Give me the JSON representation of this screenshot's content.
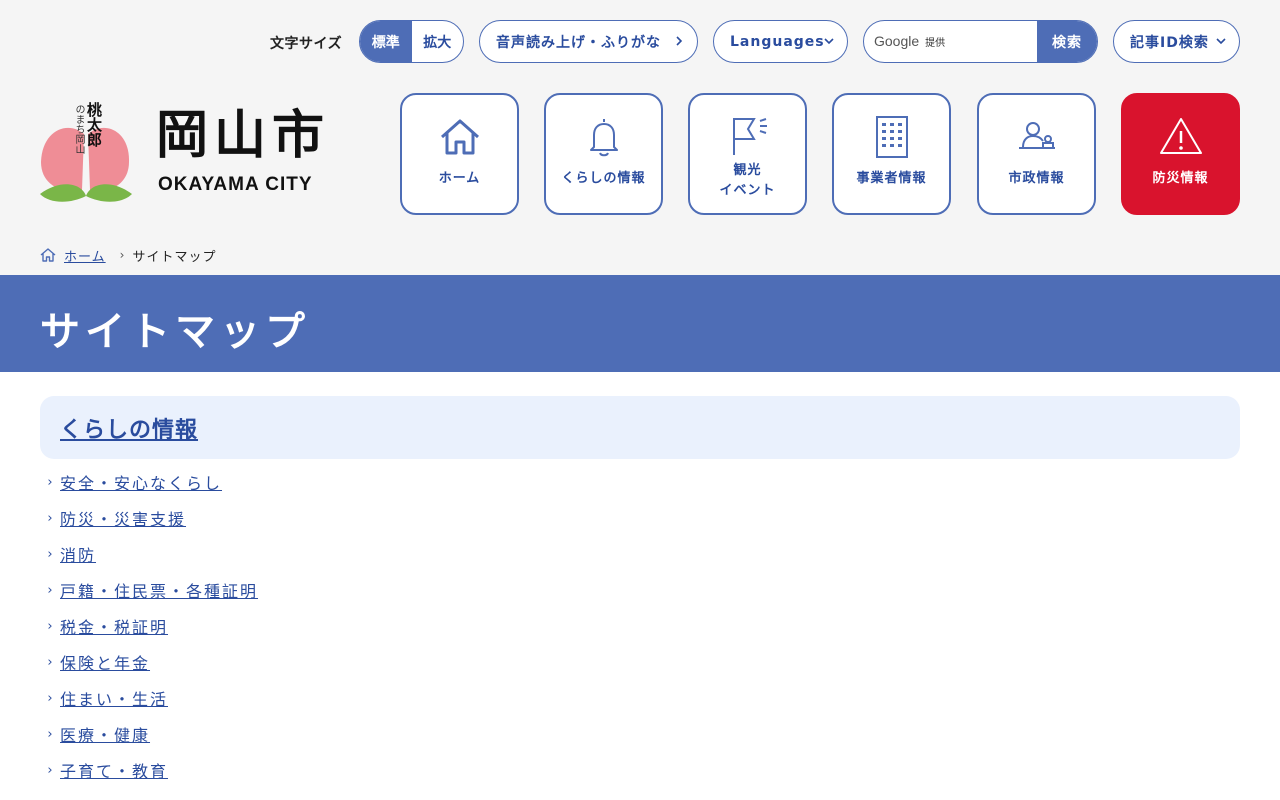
{
  "colors": {
    "brand": "#4e6db6",
    "link": "#2a4c9e",
    "danger": "#d9132d",
    "header_bg": "#f5f5f5",
    "section_bg": "#eaf1fd"
  },
  "utility": {
    "font_size_label": "文字サイズ",
    "font_size_options": [
      "標準",
      "拡大"
    ],
    "font_size_selected": "標準",
    "read_aloud_label": "音声読み上げ・ふりがな",
    "languages_label": "Languages",
    "search": {
      "provider_text": "Google",
      "provider_suffix": "提供",
      "button_label": "検索"
    },
    "article_id_label": "記事ID検索"
  },
  "logo": {
    "mascot_caption": "のまち岡山",
    "mascot_name": "桃太郎",
    "kanji_title": "岡山市",
    "roman_title": "OKAYAMA CITY"
  },
  "nav": [
    {
      "label": "ホーム",
      "icon": "home-icon"
    },
    {
      "label": "くらしの情報",
      "icon": "bell-icon"
    },
    {
      "label": "観光\nイベント",
      "icon": "flag-icon"
    },
    {
      "label": "事業者情報",
      "icon": "building-icon"
    },
    {
      "label": "市政情報",
      "icon": "speaker-podium-icon"
    },
    {
      "label": "防災情報",
      "icon": "warning-icon"
    }
  ],
  "breadcrumb": {
    "home": "ホーム",
    "current": "サイトマップ"
  },
  "page_title": "サイトマップ",
  "section": {
    "title": "くらしの情報",
    "links": [
      "安全・安心なくらし",
      "防災・災害支援",
      "消防",
      "戸籍・住民票・各種証明",
      "税金・税証明",
      "保険と年金",
      "住まい・生活",
      "医療・健康",
      "子育て・教育"
    ]
  }
}
